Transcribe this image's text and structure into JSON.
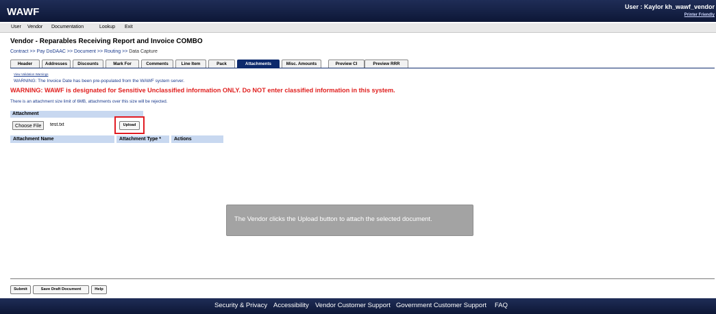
{
  "app": {
    "logo": "WAWF",
    "user_text": "User : Kaylor kh_wawf_vendor",
    "printer_friendly": "Printer Friendly"
  },
  "menu": [
    "User",
    "Vendor",
    "Documentation",
    "Lookup",
    "Exit"
  ],
  "page_title": "Vendor - Reparables Receiving Report and Invoice COMBO",
  "breadcrumb": {
    "items": [
      "Contract",
      "Pay DoDAAC",
      "Document",
      "Routing"
    ],
    "separator": ">>",
    "current": "Data Capture"
  },
  "tabs": [
    {
      "label": "Header",
      "active": false
    },
    {
      "label": "Addresses",
      "active": false
    },
    {
      "label": "Discounts",
      "active": false
    },
    {
      "label": "Mark For",
      "active": false
    },
    {
      "label": "Comments",
      "active": false
    },
    {
      "label": "Line Item",
      "active": false
    },
    {
      "label": "Pack",
      "active": false
    },
    {
      "label": "Attachments",
      "active": true
    },
    {
      "label": "Misc. Amounts",
      "active": false
    },
    {
      "label": "Preview CI",
      "active": false
    },
    {
      "label": "Preview RRR",
      "active": false
    }
  ],
  "messages": {
    "view_validation": "View Validation Warnings",
    "invoice_date_notice": "WARNING: The Invoice Date has been pre-populated from the WAWF system server.",
    "sensitive_warning": "WARNING: WAWF is designated for Sensitive Unclassified information ONLY. Do NOT enter classified information in this system.",
    "size_limit": "There is an attachment size limit of 6MB, attachments over this size will be rejected."
  },
  "attachment": {
    "header": "Attachment",
    "choose_file_label": "Choose File",
    "selected_file": "test.txt",
    "upload_label": "Upload",
    "columns": [
      "Attachment Name",
      "Attachment Type *",
      "Actions"
    ]
  },
  "callout": {
    "text": "The Vendor clicks the Upload button to attach the selected document."
  },
  "bottom_buttons": [
    "Submit",
    "Save Draft Document",
    "Help"
  ],
  "footer_links": [
    "Security & Privacy",
    "Accessibility",
    "Vendor Customer Support",
    "Government Customer Support",
    "FAQ"
  ],
  "colors": {
    "banner": "#0d1736",
    "active_tab": "#0d2a6c",
    "warning_red": "#e0201f",
    "link_blue": "#1a3a8c",
    "table_header": "#c8d8f0",
    "highlight_box": "#e11b22"
  }
}
